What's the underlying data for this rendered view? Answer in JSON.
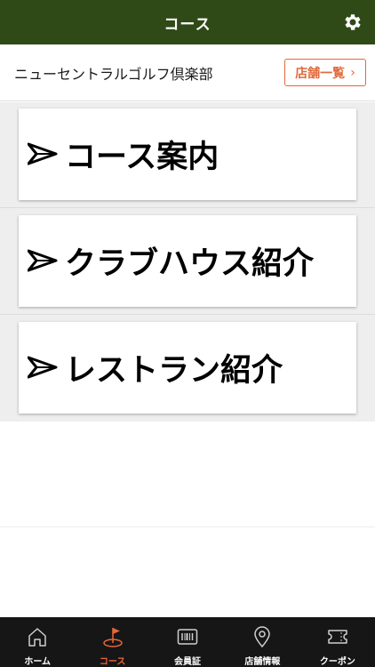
{
  "header": {
    "title": "コース"
  },
  "store": {
    "name": "ニューセントラルゴルフ倶楽部",
    "list_button": "店舗一覧",
    "chevron": "›"
  },
  "menu": {
    "items": [
      {
        "label": "コース案内"
      },
      {
        "label": "クラブハウス紹介"
      },
      {
        "label": "レストラン紹介"
      }
    ]
  },
  "tabs": [
    {
      "label": "ホーム",
      "icon": "home-icon"
    },
    {
      "label": "コース",
      "icon": "golf-flag-icon"
    },
    {
      "label": "会員証",
      "icon": "barcode-icon"
    },
    {
      "label": "店舗情報",
      "icon": "location-pin-icon"
    },
    {
      "label": "クーポン",
      "icon": "ticket-icon"
    }
  ],
  "colors": {
    "header_bg": "#2f4a17",
    "accent": "#e06a3c",
    "active_tab": "#e8663a",
    "tabbar_bg": "#161616",
    "menu_bg": "#eeeeee"
  },
  "active_tab_index": 1
}
